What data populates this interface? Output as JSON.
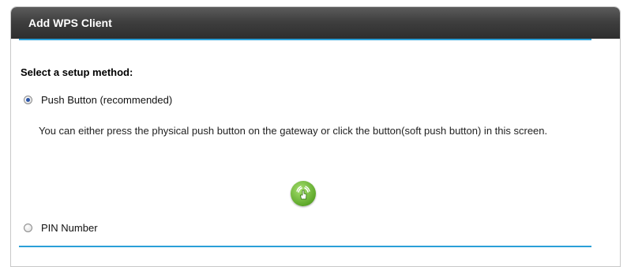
{
  "panel": {
    "title": "Add WPS Client"
  },
  "setup": {
    "heading": "Select a setup method:",
    "options": [
      {
        "label": "Push Button (recommended)",
        "selected": true
      },
      {
        "label": "PIN Number",
        "selected": false
      }
    ],
    "push_description": "You can either press the physical push button on the gateway or click the button(soft push button) in this screen."
  },
  "colors": {
    "accent_rule": "#2a9fd8",
    "wps_button": "#5ea82a",
    "header_bg": "#3f3f3f"
  },
  "icons": {
    "wps_soft_button": "wps-push-button-icon"
  }
}
